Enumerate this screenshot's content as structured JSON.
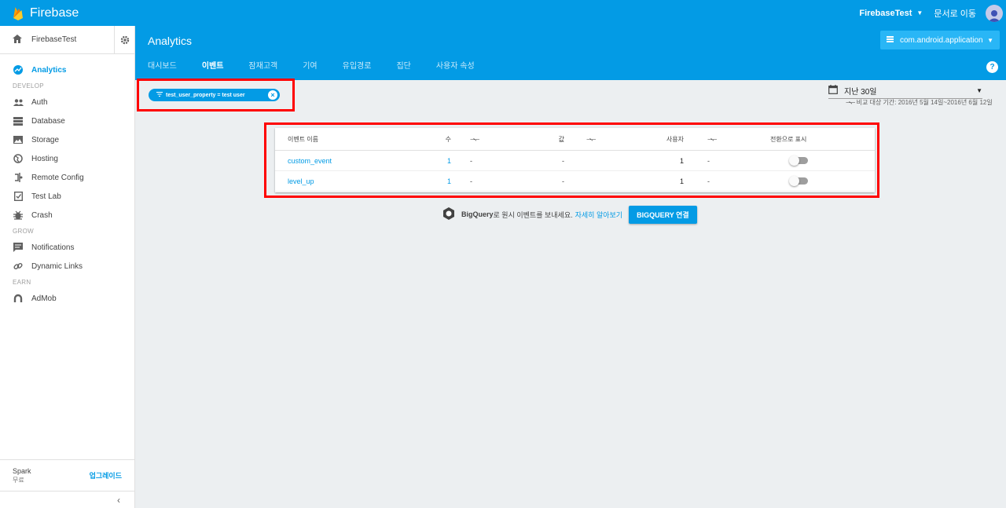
{
  "topbar": {
    "brand": "Firebase",
    "project": "FirebaseTest",
    "docs": "문서로 이동"
  },
  "sidebar": {
    "project_name": "FirebaseTest",
    "items_top": [
      {
        "label": "Analytics",
        "icon": "analytics-icon",
        "active": true
      }
    ],
    "sections": [
      {
        "title": "DEVELOP",
        "items": [
          {
            "label": "Auth",
            "icon": "people-icon"
          },
          {
            "label": "Database",
            "icon": "database-icon"
          },
          {
            "label": "Storage",
            "icon": "image-icon"
          },
          {
            "label": "Hosting",
            "icon": "globe-icon"
          },
          {
            "label": "Remote Config",
            "icon": "remote-config-icon"
          },
          {
            "label": "Test Lab",
            "icon": "checklist-icon"
          },
          {
            "label": "Crash",
            "icon": "bug-icon"
          }
        ]
      },
      {
        "title": "GROW",
        "items": [
          {
            "label": "Notifications",
            "icon": "message-icon"
          },
          {
            "label": "Dynamic Links",
            "icon": "link-icon"
          }
        ]
      },
      {
        "title": "EARN",
        "items": [
          {
            "label": "AdMob",
            "icon": "admob-icon"
          }
        ]
      }
    ],
    "plan": {
      "name": "Spark",
      "price": "무료",
      "upgrade": "업그레이드"
    },
    "collapse": "‹"
  },
  "header": {
    "title": "Analytics",
    "app": "com.android.application",
    "tabs": [
      "대시보드",
      "이벤트",
      "잠재고객",
      "기여",
      "유입경로",
      "집단",
      "사용자 속성"
    ],
    "active_tab": 1,
    "help": "?"
  },
  "filter_chip": {
    "label": "test_user_property = test user"
  },
  "date_range": {
    "label": "지난 30일",
    "compare": "비교 대상 기간: 2016년 5월 14일~2016년 6월 12일"
  },
  "table": {
    "headers": {
      "name": "이벤트 이름",
      "count": "수",
      "value": "값",
      "users": "사용자",
      "conversion": "전환으로 표시"
    },
    "rows": [
      {
        "name": "custom_event",
        "count": "1",
        "count_change": "-",
        "value": "-",
        "users": "1",
        "users_change": "-",
        "conversion": false
      },
      {
        "name": "level_up",
        "count": "1",
        "count_change": "-",
        "value": "-",
        "users": "1",
        "users_change": "-",
        "conversion": false
      }
    ]
  },
  "bigquery": {
    "name": "BigQuery",
    "text": "로 원시 이벤트를 보내세요.",
    "link": "자세히 알아보기",
    "button": "BIGQUERY 연결"
  }
}
